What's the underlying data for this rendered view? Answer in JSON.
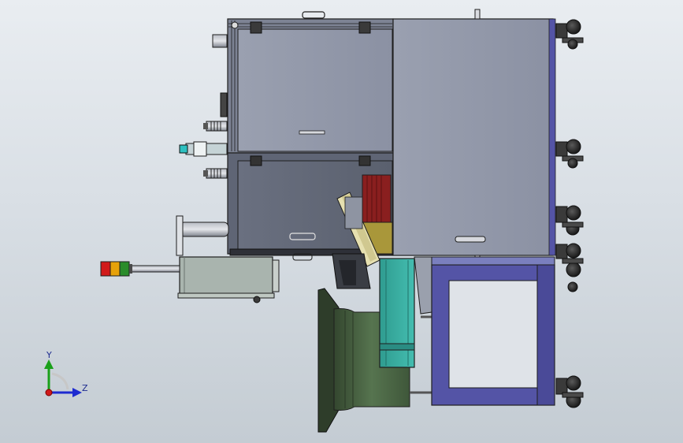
{
  "viewport": {
    "background_top": "#e9edf1",
    "background_bottom": "#c4ccd3"
  },
  "colors": {
    "cabinet": "#8f95a6",
    "cabinet_dark": "#5c6270",
    "outline": "#1e1e1e",
    "frame_blue": "#5454a6",
    "teal": "#3bb0a3",
    "dark_green": "#4d6a46",
    "red": "#8a1f1f",
    "gold": "#a9973a",
    "cream": "#e6e0b0",
    "gray_green": "#a9b4ae"
  },
  "model_parts": [
    "upper-drawer",
    "lower-drawer",
    "right-cabinet",
    "control-box",
    "signal-tower",
    "teal-fan-housing",
    "green-bell-housing",
    "blue-frame",
    "casters"
  ],
  "triad": {
    "y_label": "Y",
    "z_label": "Z",
    "y_color": "#1aa01a",
    "z_color": "#1d2bd0",
    "x_color": "#d01a1a"
  }
}
